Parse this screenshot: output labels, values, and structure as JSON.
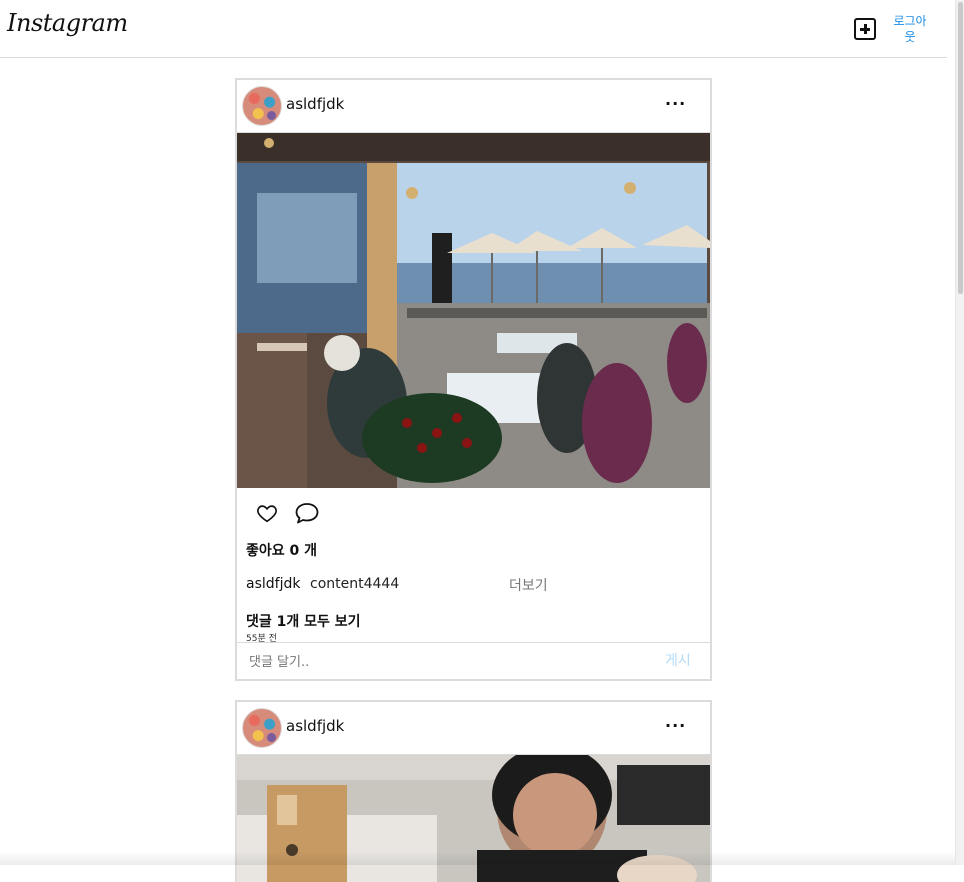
{
  "header": {
    "logo": "Instagram",
    "add_icon": "plus-square-icon",
    "logout_label": "로그아웃"
  },
  "posts": [
    {
      "username": "asldfjdk",
      "more": "···",
      "likes": "좋아요 0 개",
      "caption_user": "asldfjdk",
      "caption": "content4444",
      "more_label": "더보기",
      "view_comments": "댓글 1개 모두 보기",
      "time": "55분 전",
      "comment_placeholder": "댓글 달기..",
      "post_label": "게시"
    },
    {
      "username": "asldfjdk",
      "more": "···"
    }
  ],
  "colors": {
    "accent": "#1a8ce6",
    "disabled_post": "#b3dbf5",
    "border": "#dbdbdb"
  }
}
